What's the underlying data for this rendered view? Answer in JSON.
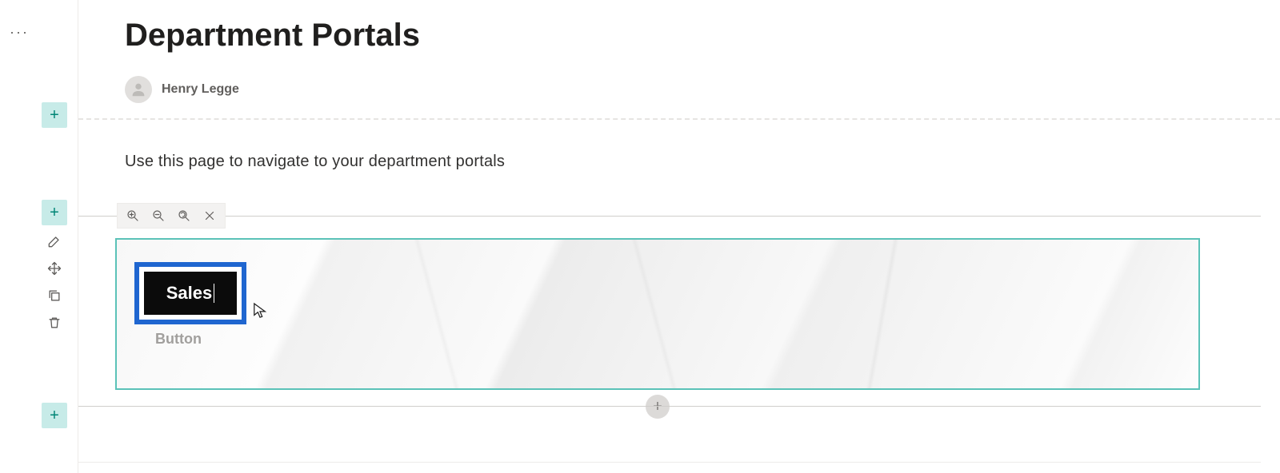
{
  "page": {
    "title": "Department Portals",
    "author": "Henry Legge",
    "intro": "Use this page to navigate to your department portals"
  },
  "webpart": {
    "buttons": [
      {
        "label": "Sales",
        "selected": true,
        "editing": true
      },
      {
        "label": "Button",
        "selected": false,
        "editing": false
      }
    ]
  },
  "rail": {
    "add_label": "+",
    "section_tools": [
      "edit-section",
      "move-section",
      "duplicate-section",
      "delete-section"
    ],
    "webpart_tools": [
      "edit-webpart",
      "move-webpart",
      "duplicate-webpart",
      "delete-webpart"
    ]
  },
  "zoom_bar": {
    "items": [
      "zoom-in",
      "zoom-out",
      "zoom-reset",
      "close"
    ]
  },
  "icons": {
    "ellipsis": "···",
    "plus": "+"
  }
}
